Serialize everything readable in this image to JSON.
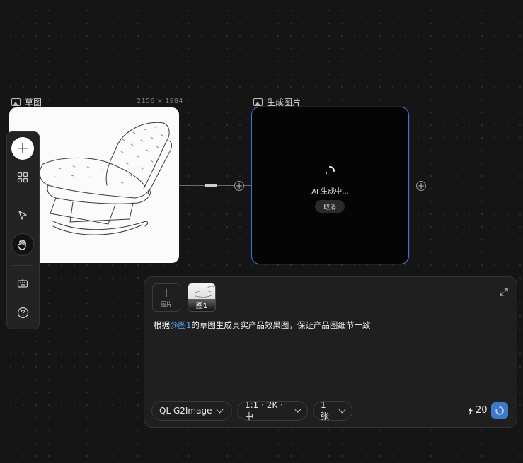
{
  "nodes": {
    "sketch": {
      "label": "草图",
      "dimensions": "2156 × 1984",
      "icon": "image-icon"
    },
    "generate": {
      "label": "生成图片",
      "icon": "image-icon",
      "status_text": "AI 生成中...",
      "cancel_label": "取消"
    }
  },
  "toolbar": {
    "items": [
      "add-icon",
      "grid-icon",
      "pointer-icon",
      "hand-icon",
      "keyboard-icon",
      "help-icon"
    ]
  },
  "prompt_panel": {
    "add_image_icon": "+",
    "add_image_label": "图片",
    "thumbnail_label": "图1",
    "prompt_prefix": "根据",
    "prompt_mention": "@图1",
    "prompt_suffix": "的草图生成真实产品效果图，保证产品图细节一致",
    "model": "QL G2Image",
    "settings": "1:1 · 2K · 中",
    "count": "1张",
    "credits": "20"
  },
  "colors": {
    "canvas_bg": "#151515",
    "accent": "#3d78c9",
    "mention": "#5aa2f0",
    "panel_bg": "#1f1f1f"
  }
}
